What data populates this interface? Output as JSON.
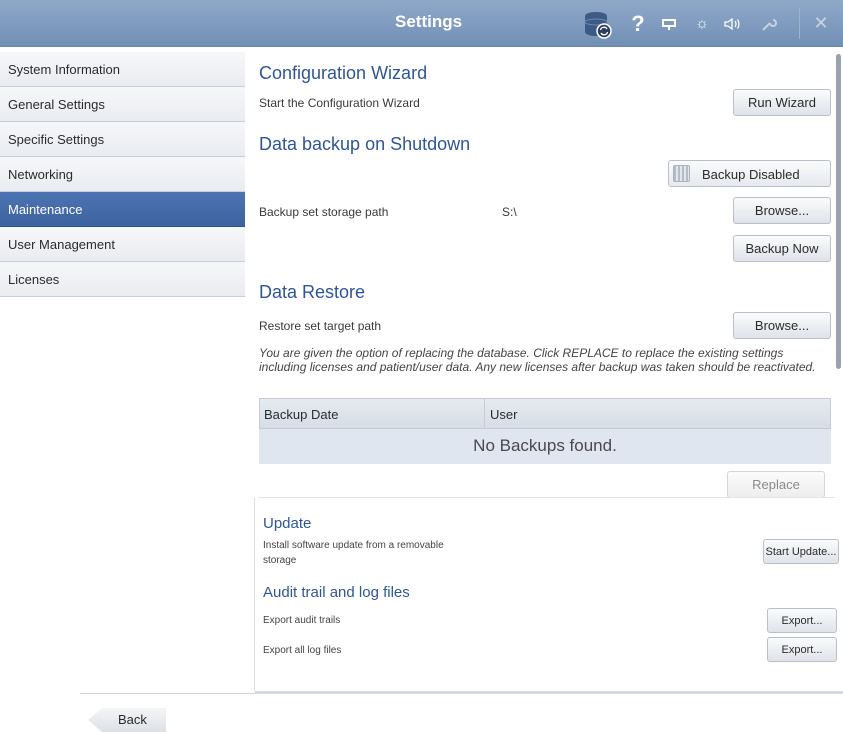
{
  "window": {
    "title": "Settings",
    "icons": [
      "database-sync-icon",
      "help-icon",
      "display-icon",
      "brightness-icon",
      "volume-icon",
      "wrench-icon",
      "close-icon"
    ]
  },
  "sidebar": {
    "items": [
      {
        "label": "System Information",
        "active": false
      },
      {
        "label": "General Settings",
        "active": false
      },
      {
        "label": "Specific Settings",
        "active": false
      },
      {
        "label": "Networking",
        "active": false
      },
      {
        "label": "Maintenance",
        "active": true
      },
      {
        "label": "User Management",
        "active": false
      },
      {
        "label": "Licenses",
        "active": false
      }
    ]
  },
  "main": {
    "wizard": {
      "title": "Configuration Wizard",
      "description": "Start the Configuration Wizard",
      "button": "Run Wizard"
    },
    "backup": {
      "title": "Data backup on Shutdown",
      "toggle_label": "Backup Disabled",
      "path_label": "Backup set storage path",
      "path_value": "S:\\",
      "browse_button": "Browse...",
      "backup_now_button": "Backup Now"
    },
    "restore": {
      "title": "Data Restore",
      "path_label": "Restore set target path",
      "browse_button": "Browse...",
      "note": "You are given the option of replacing the database. Click REPLACE to replace the existing settings including licenses and patient/user data. Any new licenses after backup was taken should be reactivated.",
      "table": {
        "columns": [
          "Backup Date",
          "User"
        ],
        "empty_message": "No Backups found."
      },
      "replace_button": "Replace"
    }
  },
  "lower": {
    "update": {
      "title": "Update",
      "description": "Install software update from a removable storage",
      "button": "Start Update..."
    },
    "audit": {
      "title": "Audit trail and log files",
      "rows": [
        {
          "label": "Export audit trails",
          "button": "Export..."
        },
        {
          "label": "Export all log files",
          "button": "Export..."
        }
      ]
    }
  },
  "footer": {
    "back_label": "Back"
  },
  "colors": {
    "titlebar": "#7f9bc0",
    "active_nav": "#4469a8",
    "section_title": "#2f5597"
  }
}
